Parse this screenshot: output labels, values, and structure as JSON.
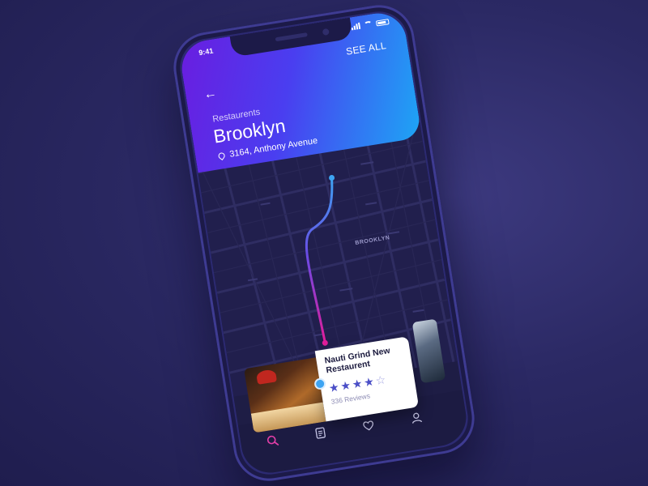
{
  "status_bar": {
    "time": "9:41"
  },
  "header": {
    "see_all": "SEE ALL",
    "back": "←",
    "category": "Restaurents",
    "city": "Brooklyn",
    "address": "3164, Anthony Avenue"
  },
  "map": {
    "area_label": "BROOKLYN"
  },
  "card": {
    "title": "Nauti Grind New Restaurent",
    "rating": 4,
    "max_rating": 5,
    "reviews": "336 Reviews"
  },
  "tabs": [
    {
      "name": "search",
      "icon": "search-icon",
      "active": true
    },
    {
      "name": "list",
      "icon": "document-icon",
      "active": false
    },
    {
      "name": "favorites",
      "icon": "heart-icon",
      "active": false
    },
    {
      "name": "profile",
      "icon": "user-icon",
      "active": false
    }
  ],
  "colors": {
    "gradient_start": "#6a1de0",
    "gradient_end": "#1da6f5",
    "route_start": "#e01e9c",
    "route_end": "#3da4f2",
    "tab_active": "#e23fa8",
    "tab_inactive": "#c9c8e8"
  }
}
